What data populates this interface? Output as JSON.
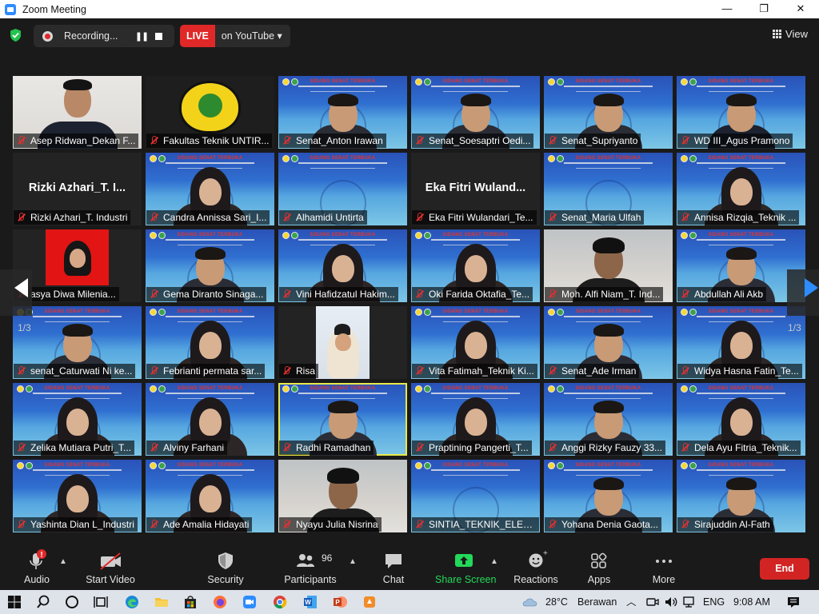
{
  "window": {
    "title": "Zoom Meeting",
    "min": "—",
    "max": "❐",
    "close": "✕"
  },
  "topbar": {
    "recording_label": "Recording...",
    "pause_glyph": "❚❚",
    "live_label": "LIVE",
    "live_target": "on YouTube ▾",
    "view_label": "View"
  },
  "gallery": {
    "page_label": "1/3",
    "tiles": [
      {
        "name": "Asep Ridwan_Dekan F...",
        "kind": "person-suit"
      },
      {
        "name": "Fakultas Teknik UNTIR...",
        "kind": "logo"
      },
      {
        "name": "Senat_Anton Irawan",
        "kind": "slide-person"
      },
      {
        "name": "Senat_Soesaptri Oedi...",
        "kind": "slide-person"
      },
      {
        "name": "Senat_Supriyanto",
        "kind": "slide-person"
      },
      {
        "name": "WD III_Agus Pramono",
        "kind": "slide-person-dark"
      },
      {
        "name": "Rizki Azhari_T. Industri",
        "kind": "bigname",
        "big": "Rizki Azhari_T. I..."
      },
      {
        "name": "Candra Annissa Sari_I...",
        "kind": "slide-hijab"
      },
      {
        "name": "Alhamidi Untirta",
        "kind": "slide"
      },
      {
        "name": "Eka Fitri Wulandari_Te...",
        "kind": "bigname",
        "big": "Eka Fitri Wuland..."
      },
      {
        "name": "Senat_Maria Ulfah",
        "kind": "slide"
      },
      {
        "name": "Annisa Rizqia_Teknik ...",
        "kind": "slide-hijab"
      },
      {
        "name": "asya Diwa Milenia...",
        "kind": "red-photo"
      },
      {
        "name": "Gema Diranto Sinaga...",
        "kind": "slide-person"
      },
      {
        "name": "Vini Hafidzatul Hakim...",
        "kind": "slide-hijab"
      },
      {
        "name": "Oki Farida Oktafia_Te...",
        "kind": "slide-hijab"
      },
      {
        "name": "Moh. Alfi Niam_T. Ind...",
        "kind": "room-person"
      },
      {
        "name": "Abdullah Ali Akb",
        "kind": "slide-person"
      },
      {
        "name": "senat_Caturwati Ni ke...",
        "kind": "slide-person"
      },
      {
        "name": "Febrianti permata sar...",
        "kind": "slide-hijab"
      },
      {
        "name": "Risa",
        "kind": "small-hijab"
      },
      {
        "name": "Vita Fatimah_Teknik Ki...",
        "kind": "slide-hijab"
      },
      {
        "name": "Senat_Ade Irman",
        "kind": "slide-person"
      },
      {
        "name": "Widya Hasna Fatin_Te...",
        "kind": "slide-hijab"
      },
      {
        "name": "Zelika Mutiara Putri_T...",
        "kind": "slide-hijab"
      },
      {
        "name": "Alviny Farhani",
        "kind": "slide-hijab"
      },
      {
        "name": "Radhi Ramadhan",
        "kind": "slide-person",
        "active": true
      },
      {
        "name": "Praptining Pangerti_T...",
        "kind": "slide-hijab"
      },
      {
        "name": "Anggi Rizky Fauzy 33...",
        "kind": "slide-person"
      },
      {
        "name": "Dela Ayu Fitria_Teknik...",
        "kind": "slide-hijab"
      },
      {
        "name": "Yashinta Dian L_Industri",
        "kind": "slide-hijab"
      },
      {
        "name": "Ade Amalia Hidayati",
        "kind": "slide-hijab"
      },
      {
        "name": "Nyayu Julia Nisrina",
        "kind": "room-person"
      },
      {
        "name": "SINTIA_TEKNIK_ELEKT...",
        "kind": "slide"
      },
      {
        "name": "Yohana Denia Gaota...",
        "kind": "slide-person"
      },
      {
        "name": "Sirajuddin Al-Fath",
        "kind": "slide-person"
      }
    ],
    "slide_title": "SIDANG SENAT TERBUKA"
  },
  "toolbar": {
    "audio": "Audio",
    "start_video": "Start Video",
    "security": "Security",
    "participants": "Participants",
    "participants_count": "96",
    "chat": "Chat",
    "share_screen": "Share Screen",
    "reactions": "Reactions",
    "apps": "Apps",
    "more": "More",
    "end": "End"
  },
  "taskbar": {
    "weather_temp": "28°C",
    "weather_text": "Berawan",
    "lang": "ENG",
    "time": "9:08 AM"
  },
  "colors": {
    "accent_blue": "#2d8cff",
    "share_green": "#23d959",
    "live_red": "#e02828",
    "end_red": "#d32424",
    "active_speaker": "#e8e84a"
  }
}
